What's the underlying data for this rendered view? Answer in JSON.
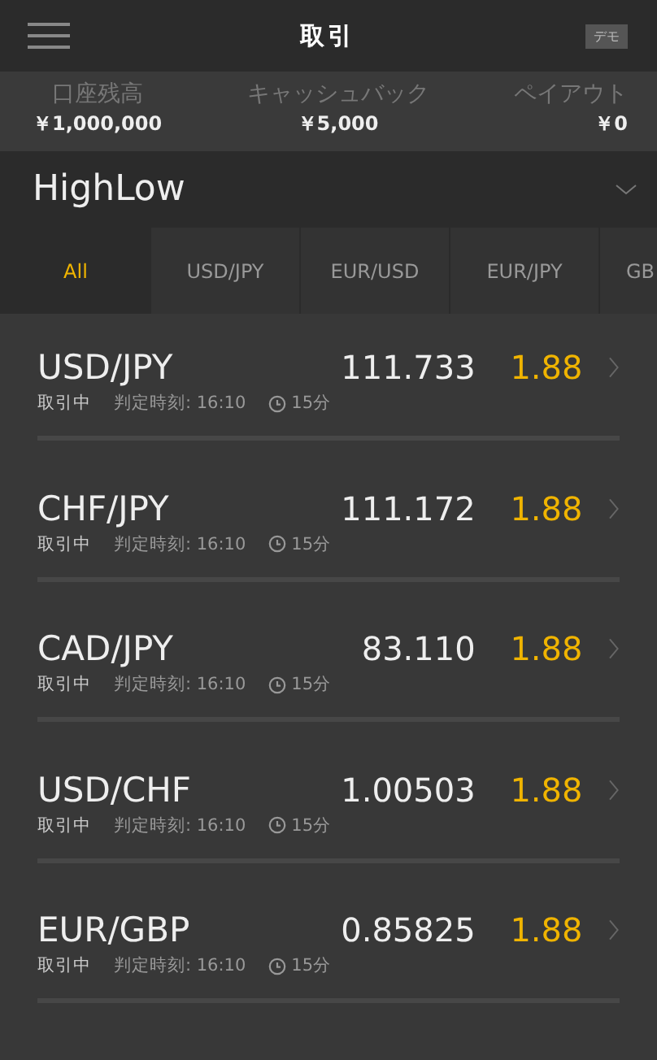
{
  "header": {
    "title": "取引",
    "badge": "デモ"
  },
  "summary": [
    {
      "label": "口座残高",
      "value": "￥1,000,000"
    },
    {
      "label": "キャッシュバック",
      "value": "￥5,000"
    },
    {
      "label": "ペイアウト",
      "value": "￥0"
    }
  ],
  "product": {
    "name": "HighLow"
  },
  "tabs": [
    {
      "label": "All",
      "selected": true
    },
    {
      "label": "USD/JPY",
      "selected": false
    },
    {
      "label": "EUR/USD",
      "selected": false
    },
    {
      "label": "EUR/JPY",
      "selected": false
    },
    {
      "label": "GB",
      "selected": false
    }
  ],
  "rows": [
    {
      "pair": "USD/JPY",
      "rate": "111.733",
      "payout": "1.88",
      "status": "取引中",
      "deadline": "判定時刻: 16:10",
      "duration": "15分"
    },
    {
      "pair": "CHF/JPY",
      "rate": "111.172",
      "payout": "1.88",
      "status": "取引中",
      "deadline": "判定時刻: 16:10",
      "duration": "15分"
    },
    {
      "pair": "CAD/JPY",
      "rate": "83.110",
      "payout": "1.88",
      "status": "取引中",
      "deadline": "判定時刻: 16:10",
      "duration": "15分"
    },
    {
      "pair": "USD/CHF",
      "rate": "1.00503",
      "payout": "1.88",
      "status": "取引中",
      "deadline": "判定時刻: 16:10",
      "duration": "15分"
    },
    {
      "pair": "EUR/GBP",
      "rate": "0.85825",
      "payout": "1.88",
      "status": "取引中",
      "deadline": "判定時刻: 16:10",
      "duration": "15分"
    }
  ]
}
